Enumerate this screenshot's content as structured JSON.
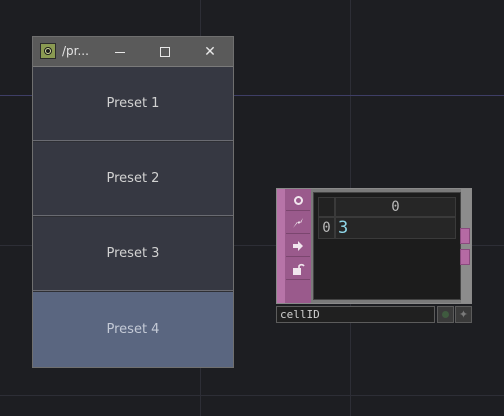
{
  "window": {
    "title": "/pr...",
    "buttons": {
      "minimize_icon": "minimize-icon",
      "maximize_icon": "maximize-icon",
      "close_glyph": "✕"
    }
  },
  "presets": [
    {
      "label": "Preset 1",
      "active": false
    },
    {
      "label": "Preset 2",
      "active": false
    },
    {
      "label": "Preset 3",
      "active": false
    },
    {
      "label": "Preset 4",
      "active": true
    }
  ],
  "table_dat": {
    "column_header": "0",
    "row_header": "0",
    "cell_value": "3",
    "operator_name": "cellID",
    "icons": [
      "viewer-toggle-icon",
      "cook-flag-icon",
      "output-arrow-icon",
      "lock-icon"
    ]
  },
  "colors": {
    "background": "#1d1e22",
    "preset_active": "#5a6680",
    "preset_idle": "#363842",
    "dat_accent": "#b774a8"
  }
}
